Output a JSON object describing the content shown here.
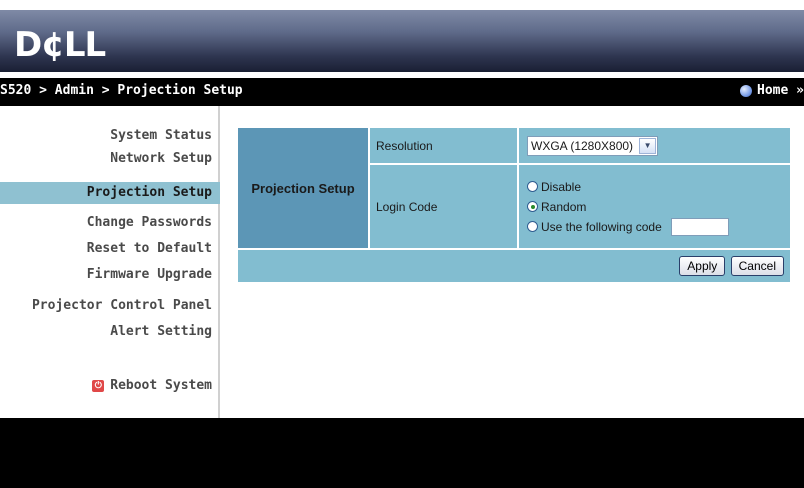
{
  "header": {
    "logo": "D¢LL"
  },
  "navbar": {
    "breadcrumb": "S520 > Admin > Projection Setup",
    "home_label": "Home »"
  },
  "sidebar": {
    "items": [
      {
        "label": "System Status"
      },
      {
        "label": "Network Setup"
      },
      {
        "label": "Projection Setup",
        "active": true
      },
      {
        "label": "Change Passwords"
      },
      {
        "label": "Reset to Default"
      },
      {
        "label": "Firmware Upgrade"
      },
      {
        "label": "Projector Control Panel"
      },
      {
        "label": "Alert Setting"
      }
    ],
    "reboot_label": "Reboot System"
  },
  "form": {
    "section_title": "Projection Setup",
    "resolution": {
      "label": "Resolution",
      "selected": "WXGA (1280X800)"
    },
    "login_code": {
      "label": "Login Code",
      "options": [
        {
          "label": "Disable",
          "checked": false
        },
        {
          "label": "Random",
          "checked": true
        },
        {
          "label": "Use the following code",
          "checked": false
        }
      ],
      "code_value": ""
    },
    "apply_label": "Apply",
    "cancel_label": "Cancel"
  },
  "colors": {
    "accent_light": "#82bdd0",
    "accent_dark": "#5c96b6",
    "active_nav": "#8fc1d1"
  }
}
